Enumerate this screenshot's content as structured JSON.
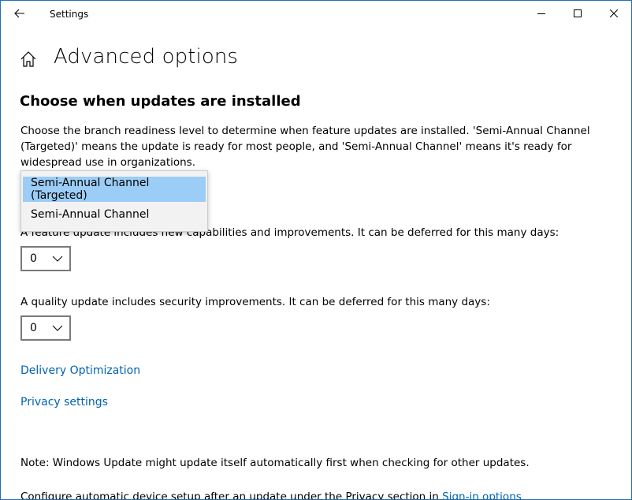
{
  "window": {
    "title": "Settings",
    "controls": {
      "minimize": "minimize",
      "maximize": "maximize",
      "close": "close"
    }
  },
  "header": {
    "page_title": "Advanced options"
  },
  "section": {
    "title": "Choose when updates are installed",
    "description": "Choose the branch readiness level to determine when feature updates are installed. 'Semi-Annual Channel (Targeted)' means the update is ready for most people, and 'Semi-Annual Channel' means it's ready for widespread use in organizations."
  },
  "branch_dropdown": {
    "options": [
      {
        "label": "Semi-Annual Channel (Targeted)",
        "selected": true
      },
      {
        "label": "Semi-Annual Channel",
        "selected": false
      }
    ]
  },
  "feature_update": {
    "label": "A feature update includes new capabilities and improvements. It can be deferred for this many days:",
    "value": "0"
  },
  "quality_update": {
    "label": "A quality update includes security improvements. It can be deferred for this many days:",
    "value": "0"
  },
  "links": {
    "delivery": "Delivery Optimization",
    "privacy": "Privacy settings"
  },
  "footer": {
    "note": "Note: Windows Update might update itself automatically first when checking for other updates.",
    "configure_text": "Configure automatic device setup after an update under the Privacy section in ",
    "configure_link": "Sign-in options"
  },
  "colors": {
    "accent_link": "#0063b1",
    "selection": "#9ccdf6",
    "window_border": "#1f6fb5"
  },
  "icons": {
    "back": "back-arrow-icon",
    "home": "home-icon",
    "chevron": "chevron-down-icon"
  }
}
